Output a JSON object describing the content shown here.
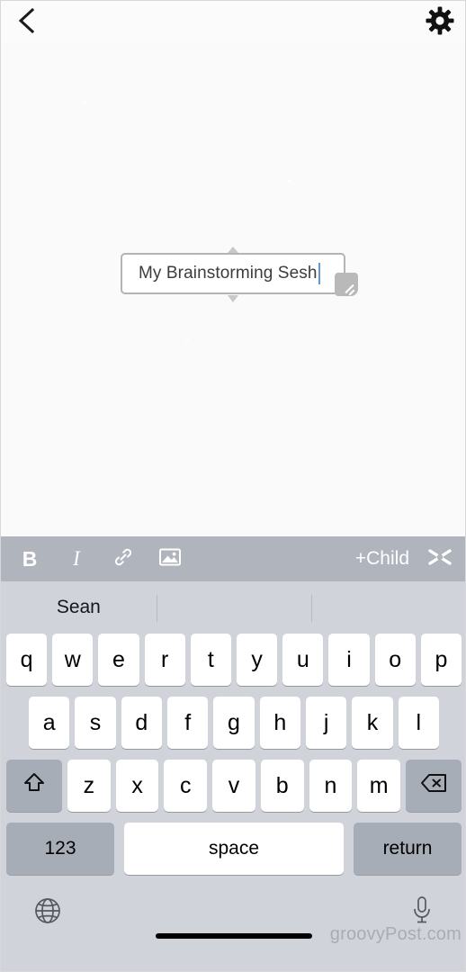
{
  "app": {
    "canvas_bg": "#fafafa",
    "toolbar_bg": "#b0b4bd",
    "keyboard_bg": "#d0d4da",
    "caret_color": "#5b9bd5"
  },
  "topbar": {
    "back_icon": "chevron-left-icon",
    "settings_icon": "gear-icon"
  },
  "node": {
    "text": "My Brainstorming Sesh",
    "has_caret": true,
    "resize_handle": "resize-grip-icon",
    "connector_top": "connector-nub-top",
    "connector_bottom": "connector-nub-bottom"
  },
  "format_toolbar": {
    "bold_label": "B",
    "italic_label": "I",
    "link_icon": "link-icon",
    "image_icon": "image-icon",
    "add_child_label": "+Child",
    "sibling_icon": "sibling-cut-icon"
  },
  "keyboard": {
    "predictions": [
      "Sean",
      "",
      ""
    ],
    "row1": [
      "q",
      "w",
      "e",
      "r",
      "t",
      "y",
      "u",
      "i",
      "o",
      "p"
    ],
    "row2": [
      "a",
      "s",
      "d",
      "f",
      "g",
      "h",
      "j",
      "k",
      "l"
    ],
    "row3": [
      "z",
      "x",
      "c",
      "v",
      "b",
      "n",
      "m"
    ],
    "shift_icon": "shift-arrow-icon",
    "backspace_icon": "backspace-icon",
    "numbers_label": "123",
    "space_label": "space",
    "return_label": "return",
    "globe_icon": "globe-icon",
    "mic_icon": "microphone-icon"
  },
  "watermark": {
    "text": "groovyPost.com"
  }
}
